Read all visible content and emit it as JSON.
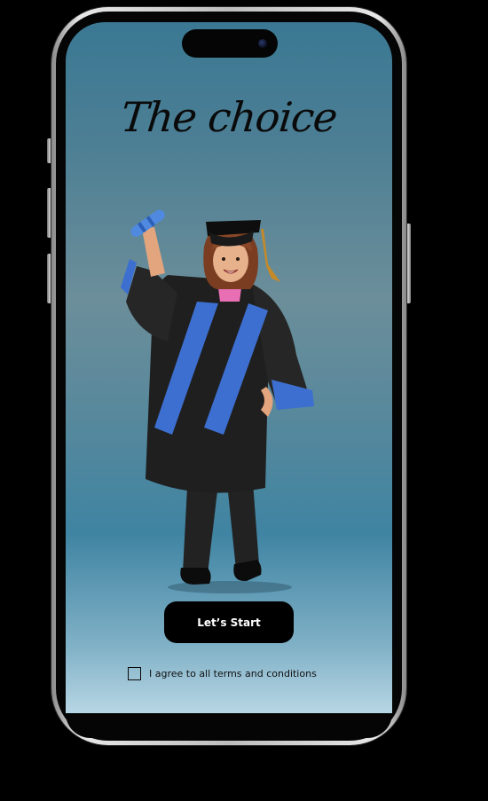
{
  "app": {
    "title": "The choice"
  },
  "actions": {
    "start_label": "Let’s Start"
  },
  "terms": {
    "label": "I agree to all terms and conditions",
    "checked": false
  },
  "colors": {
    "button_bg": "#000000",
    "button_text": "#ffffff",
    "screen_top": "#3a7893",
    "screen_bottom": "#b7d6e4",
    "sash": "#3d6fd1",
    "gown": "#1d1d1d"
  },
  "icons": {
    "illustration": "graduate-illustration",
    "checkbox": "checkbox-icon",
    "camera": "front-camera-icon"
  }
}
